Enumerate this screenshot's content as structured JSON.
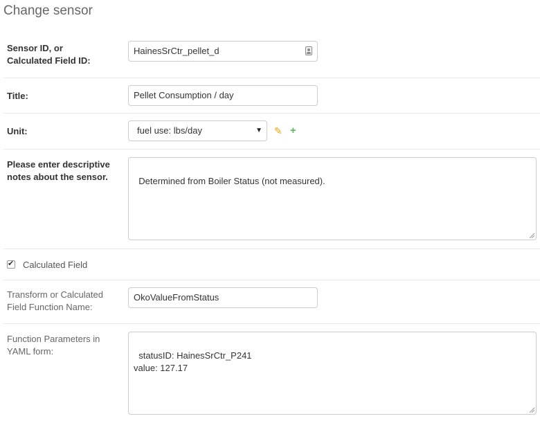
{
  "page": {
    "title": "Change sensor"
  },
  "form": {
    "sensor_id": {
      "label": "Sensor ID, or Calculated Field ID:",
      "value": "HainesSrCtr_pellet_d",
      "icon": "contact-card-icon"
    },
    "title": {
      "label": "Title:",
      "value": "Pellet Consumption / day"
    },
    "unit": {
      "label": "Unit:",
      "selected": "fuel use: lbs/day",
      "edit_icon": "pencil-icon",
      "add_icon": "plus-icon",
      "edit_color": "#f0a30a",
      "add_color": "#5cb85c"
    },
    "notes": {
      "label": "Please enter descriptive notes about the sensor.",
      "value": "Determined from Boiler Status (not measured)."
    },
    "calculated": {
      "label": "Calculated Field",
      "checked": true
    },
    "function_name": {
      "label": "Transform or Calculated Field Function Name:",
      "value": "OkoValueFromStatus"
    },
    "function_params": {
      "label": "Function Parameters in YAML form:",
      "value": "statusID: HainesSrCtr_P241\nvalue: 127.17"
    }
  }
}
